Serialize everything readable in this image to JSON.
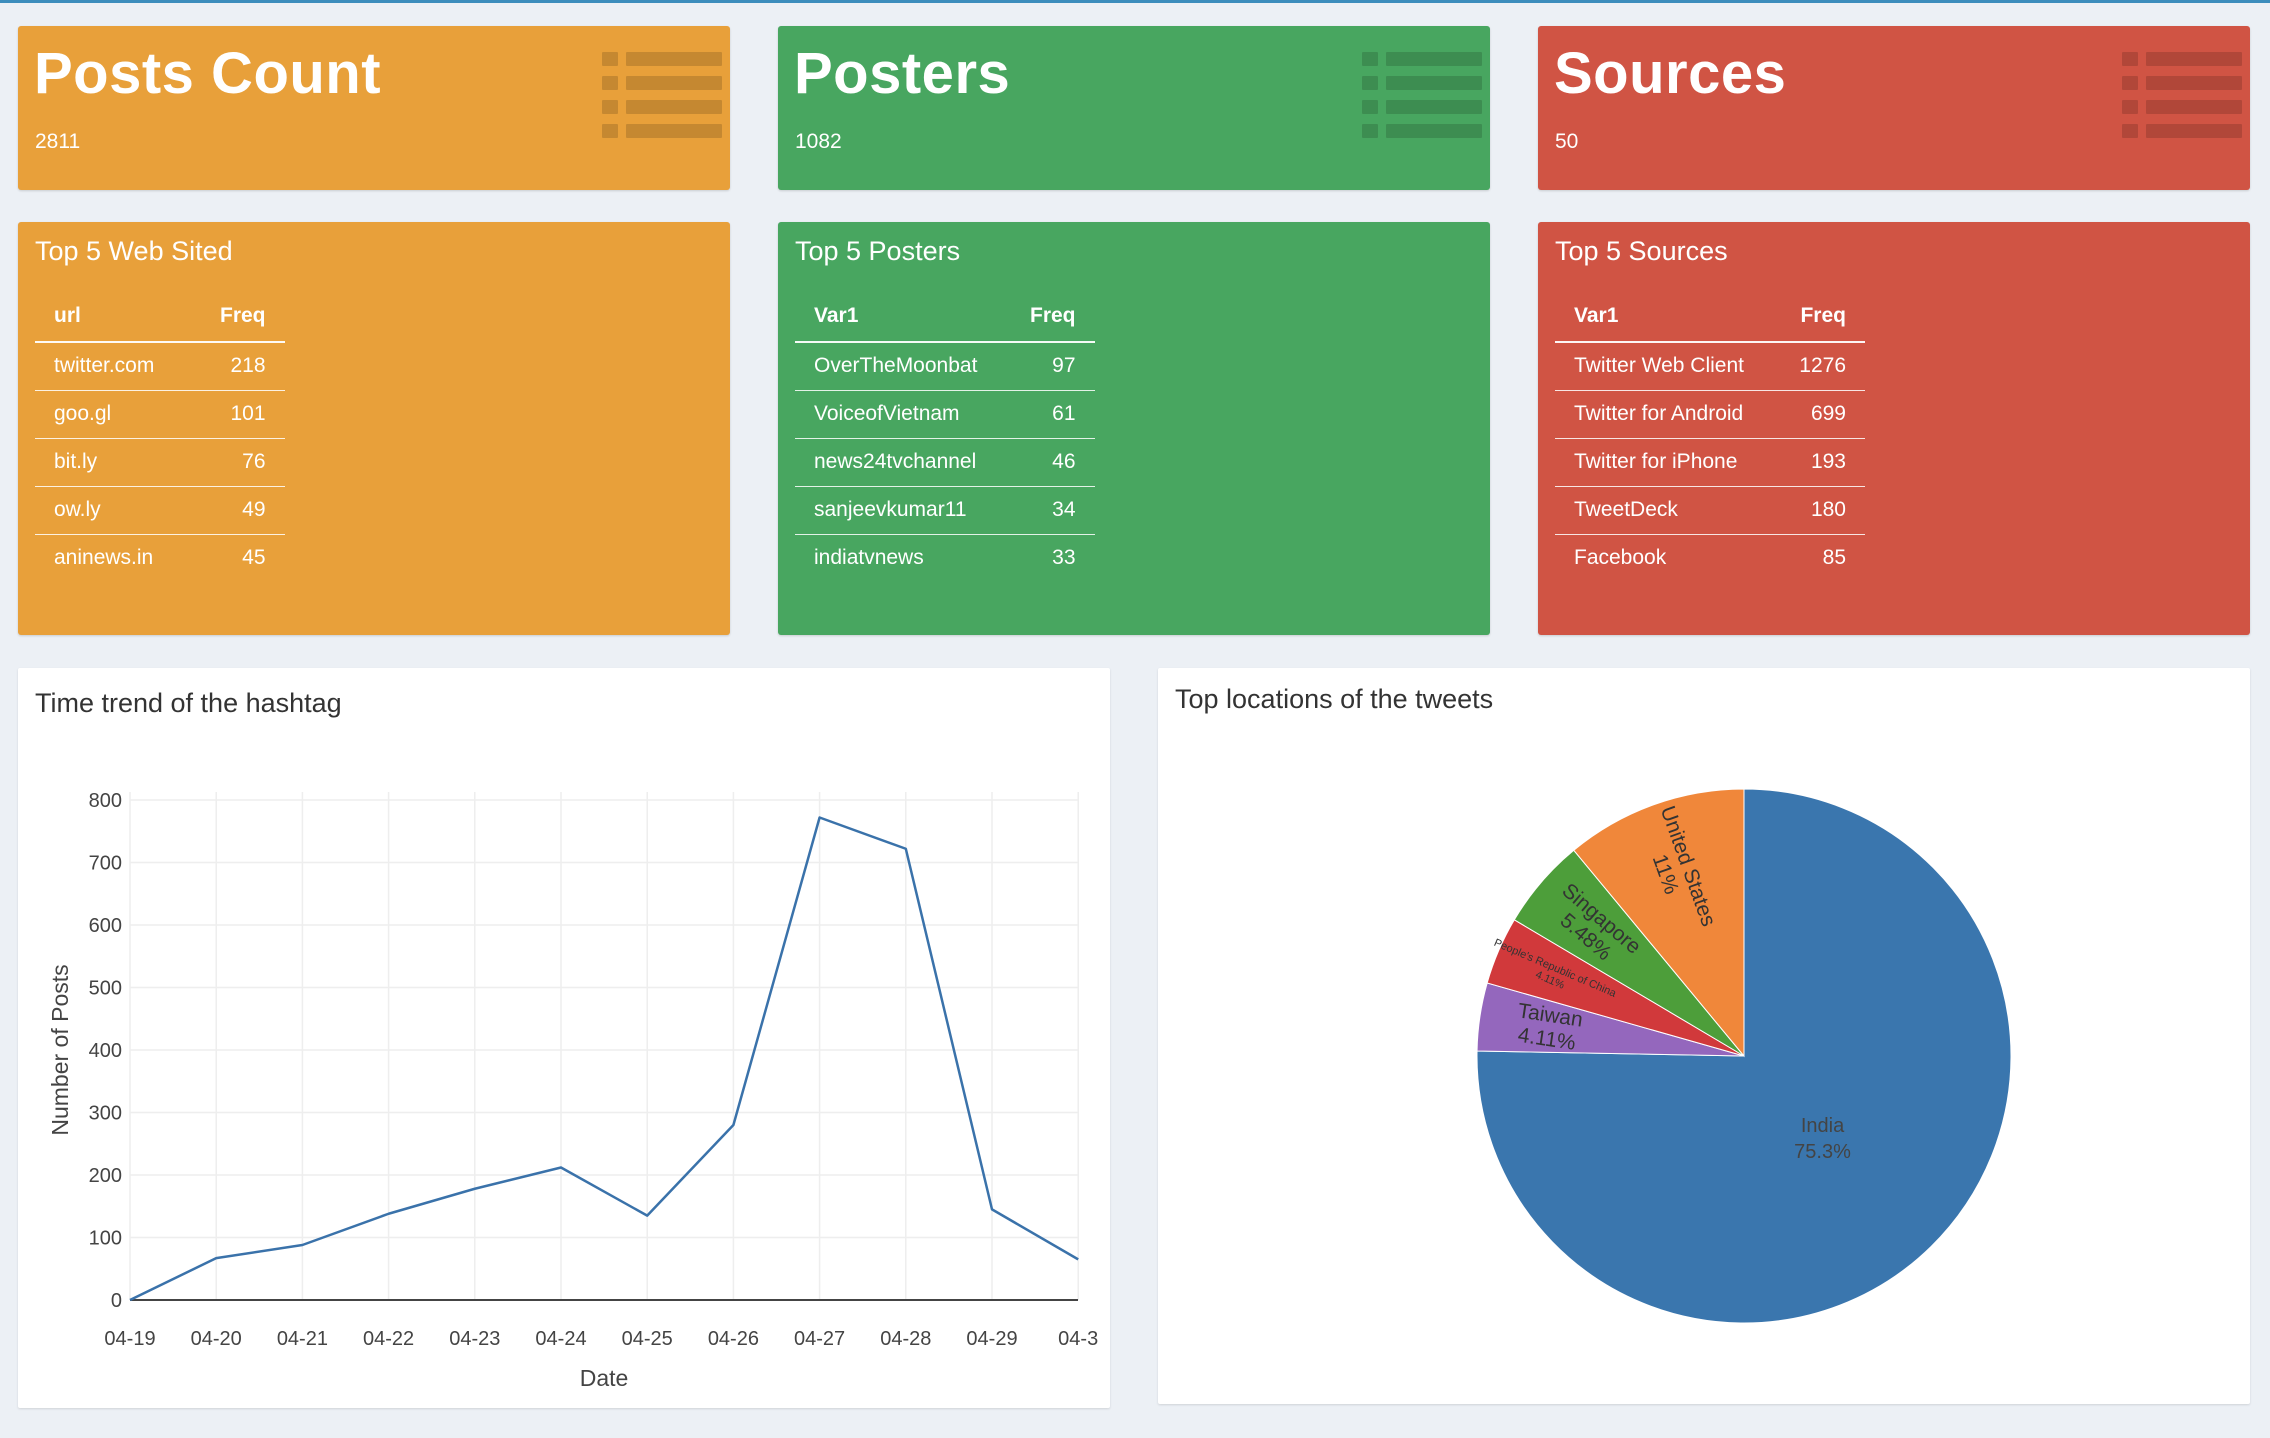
{
  "stats": [
    {
      "title": "Posts Count",
      "value": "2811",
      "color": "#e8a03a",
      "icon": "list-icon"
    },
    {
      "title": "Posters",
      "value": "1082",
      "color": "#48a660",
      "icon": "list-icon"
    },
    {
      "title": "Sources",
      "value": "50",
      "color": "#d05444",
      "icon": "list-icon"
    }
  ],
  "tables": [
    {
      "title": "Top 5 Web Sited",
      "columns": [
        "url",
        "Freq"
      ],
      "rows": [
        [
          "twitter.com",
          "218"
        ],
        [
          "goo.gl",
          "101"
        ],
        [
          "bit.ly",
          "76"
        ],
        [
          "ow.ly",
          "49"
        ],
        [
          "aninews.in",
          "45"
        ]
      ]
    },
    {
      "title": "Top 5 Posters",
      "columns": [
        "Var1",
        "Freq"
      ],
      "rows": [
        [
          "OverTheMoonbat",
          "97"
        ],
        [
          "VoiceofVietnam",
          "61"
        ],
        [
          "news24tvchannel",
          "46"
        ],
        [
          "sanjeevkumar11",
          "34"
        ],
        [
          "indiatvnews",
          "33"
        ]
      ]
    },
    {
      "title": "Top 5 Sources",
      "columns": [
        "Var1",
        "Freq"
      ],
      "rows": [
        [
          "Twitter Web Client",
          "1276"
        ],
        [
          "Twitter for Android",
          "699"
        ],
        [
          "Twitter for iPhone",
          "193"
        ],
        [
          "TweetDeck",
          "180"
        ],
        [
          "Facebook",
          "85"
        ]
      ]
    }
  ],
  "line_panel": {
    "title": "Time trend of the hashtag"
  },
  "pie_panel": {
    "title": "Top locations of the tweets"
  },
  "chart_data": [
    {
      "type": "line",
      "x": [
        "04-19",
        "04-20",
        "04-21",
        "04-22",
        "04-23",
        "04-24",
        "04-25",
        "04-26",
        "04-27",
        "04-28",
        "04-29",
        "04-3"
      ],
      "values": [
        0,
        67,
        88,
        138,
        178,
        212,
        135,
        280,
        772,
        722,
        145,
        65
      ],
      "xlabel": "Date",
      "ylabel": "Number of Posts",
      "ylim": [
        0,
        800
      ],
      "yticks": [
        0,
        100,
        200,
        300,
        400,
        500,
        600,
        700,
        800
      ],
      "grid": true,
      "color": "#3a72aa"
    },
    {
      "type": "pie",
      "slices": [
        {
          "label": "India",
          "percent_label": "75.3%",
          "value": 75.3,
          "color": "#3a76ae"
        },
        {
          "label": "Taiwan",
          "percent_label": "4.11%",
          "value": 4.11,
          "color": "#9467bd"
        },
        {
          "label": "People's Republic of China",
          "percent_label": "4.11%",
          "value": 4.11,
          "color": "#d1393b"
        },
        {
          "label": "Singapore",
          "percent_label": "5.48%",
          "value": 5.48,
          "color": "#4d9e3a"
        },
        {
          "label": "United States",
          "percent_label": "11%",
          "value": 11.0,
          "color": "#f0873a"
        }
      ]
    }
  ]
}
